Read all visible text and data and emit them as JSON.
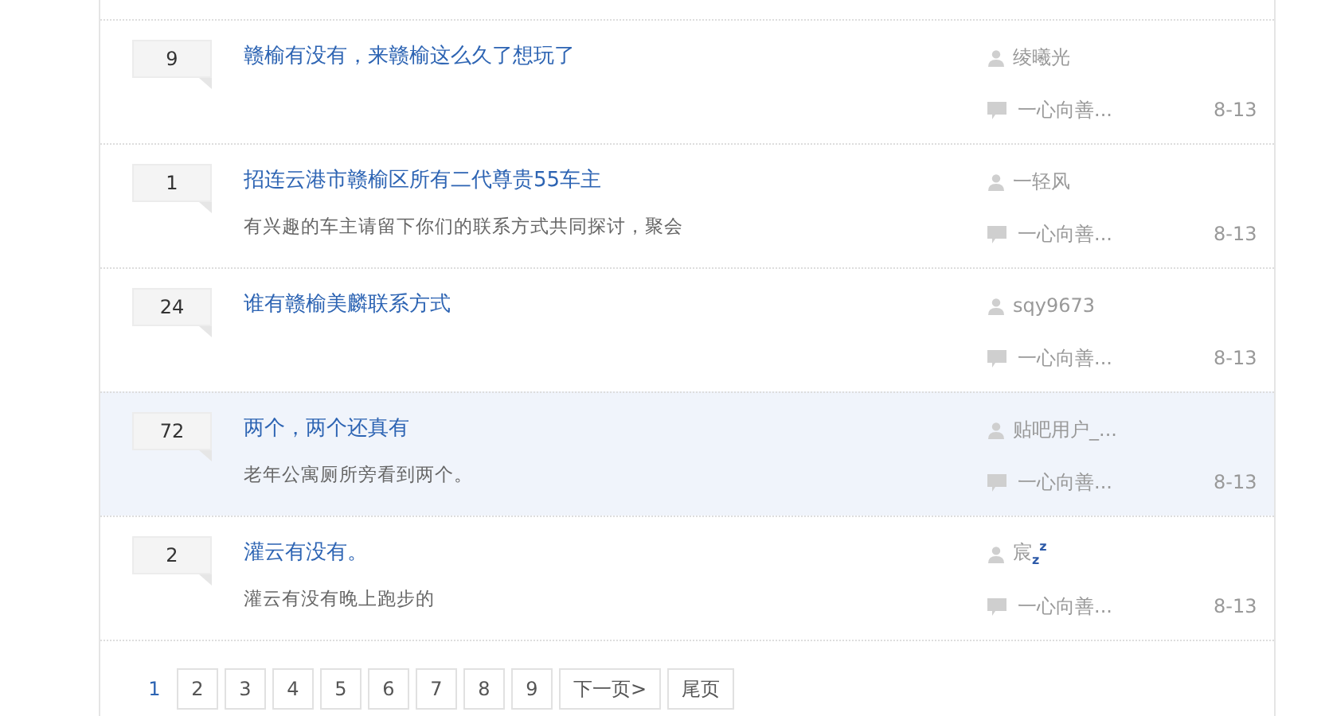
{
  "threads": [
    {
      "replies": "9",
      "title": "赣榆有没有，来赣榆这么久了想玩了",
      "author": "绫曦光",
      "last_reply": "一心向善...",
      "date": "8-13",
      "highlighted": false
    },
    {
      "replies": "1",
      "title": "招连云港市赣榆区所有二代尊贵55车主",
      "excerpt": "有兴趣的车主请留下你们的联系方式共同探讨，聚会",
      "author": "一轻风",
      "last_reply": "一心向善...",
      "date": "8-13",
      "highlighted": false
    },
    {
      "replies": "24",
      "title": "谁有赣榆美麟联系方式",
      "author": "sqy9673",
      "last_reply": "一心向善...",
      "date": "8-13",
      "highlighted": false
    },
    {
      "replies": "72",
      "title": "两个，两个还真有",
      "excerpt": "老年公寓厕所旁看到两个。",
      "author": "贴吧用户_...",
      "last_reply": "一心向善...",
      "date": "8-13",
      "highlighted": true
    },
    {
      "replies": "2",
      "title": "灌云有没有。",
      "excerpt": "灌云有没有晚上跑步的",
      "author": "宸$_{z}$$^{z}$",
      "last_reply": "一心向善...",
      "date": "8-13",
      "highlighted": false
    }
  ],
  "pagination": {
    "pages": [
      {
        "label": "1",
        "selected": true
      },
      {
        "label": "2",
        "selected": false
      },
      {
        "label": "3",
        "selected": false
      },
      {
        "label": "4",
        "selected": false
      },
      {
        "label": "5",
        "selected": false
      },
      {
        "label": "6",
        "selected": false
      },
      {
        "label": "7",
        "selected": false
      },
      {
        "label": "8",
        "selected": false
      },
      {
        "label": "9",
        "selected": false
      }
    ],
    "next": "下一页>",
    "last": "尾页"
  }
}
